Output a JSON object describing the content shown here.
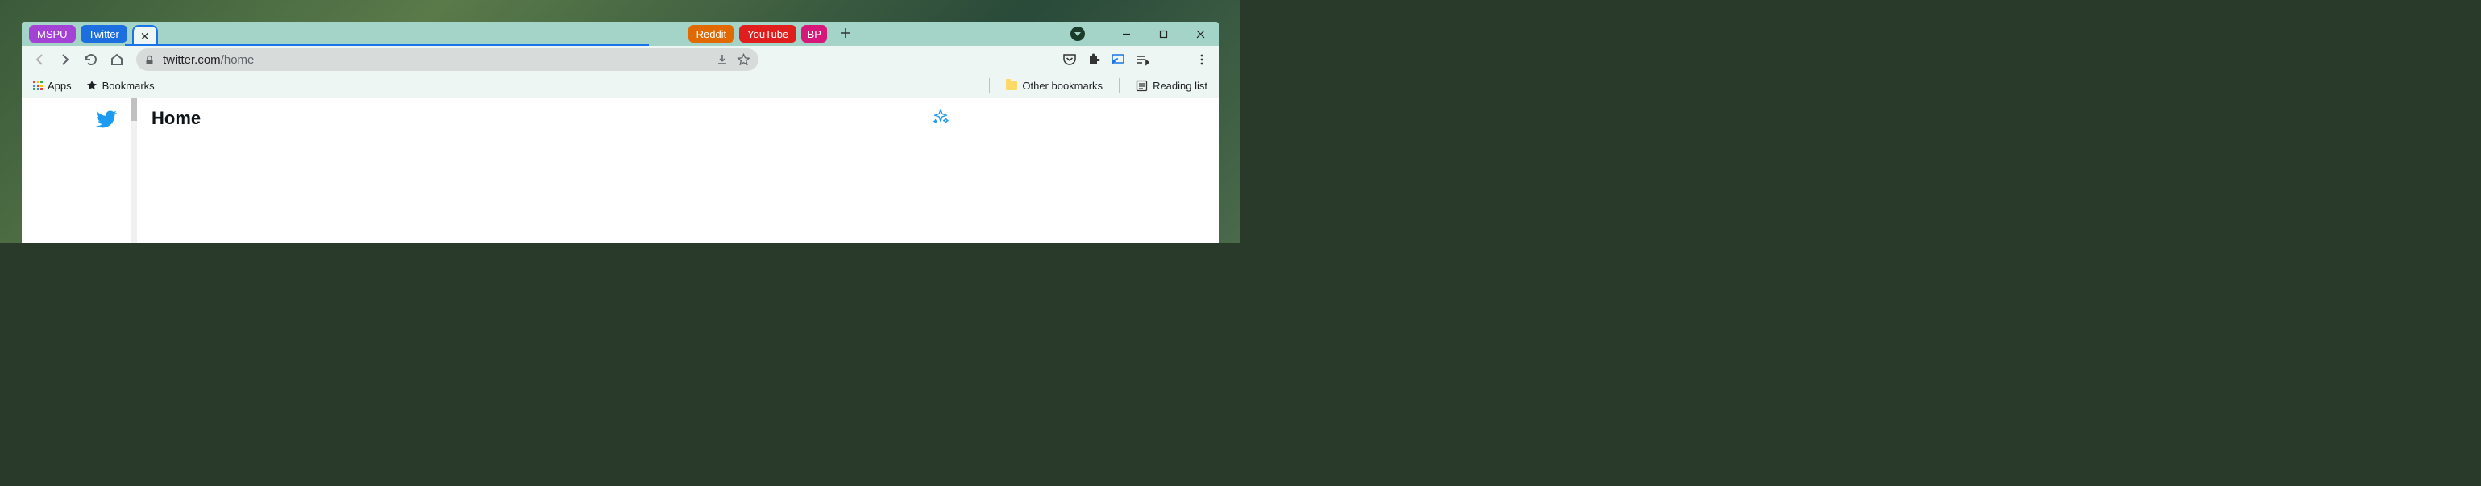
{
  "tabs": {
    "pinned_left": [
      {
        "label": "MSPU",
        "bg": "#a442d6"
      },
      {
        "label": "Twitter",
        "bg": "#1d6fe0"
      }
    ],
    "pinned_right": [
      {
        "label": "Reddit",
        "bg": "#e06a00"
      },
      {
        "label": "YouTube",
        "bg": "#e01e1e"
      },
      {
        "label": "BP",
        "bg": "#d6187a"
      }
    ]
  },
  "toolbar": {
    "url_host": "twitter.com",
    "url_path": "/home"
  },
  "bookmarks": {
    "apps": "Apps",
    "bookmarks": "Bookmarks",
    "other": "Other bookmarks",
    "reading": "Reading list"
  },
  "page": {
    "heading": "Home"
  }
}
